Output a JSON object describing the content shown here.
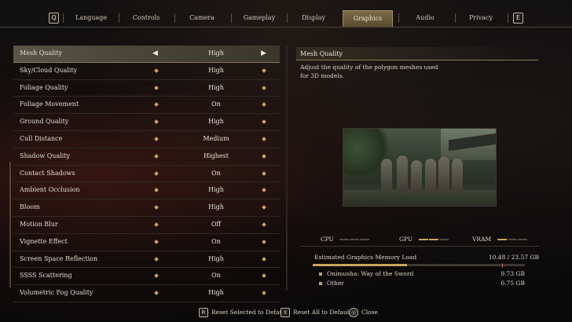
{
  "tabs": {
    "prev_key": "Q",
    "next_key": "E",
    "items": [
      "Language",
      "Controls",
      "Camera",
      "Gameplay",
      "Display",
      "Graphics",
      "Audio",
      "Privacy"
    ],
    "active": "Graphics"
  },
  "settings": [
    {
      "label": "Mesh Quality",
      "value": "High",
      "selected": true
    },
    {
      "label": "Sky/Cloud Quality",
      "value": "High"
    },
    {
      "label": "Foliage Quality",
      "value": "High"
    },
    {
      "label": "Foliage Movement",
      "value": "On"
    },
    {
      "label": "Ground Quality",
      "value": "High"
    },
    {
      "label": "Cull Distance",
      "value": "Medium"
    },
    {
      "label": "Shadow Quality",
      "value": "Highest"
    },
    {
      "label": "Contact Shadows",
      "value": "On"
    },
    {
      "label": "Ambient Occlusion",
      "value": "High"
    },
    {
      "label": "Bloom",
      "value": "High"
    },
    {
      "label": "Motion Blur",
      "value": "Off"
    },
    {
      "label": "Vignette Effect",
      "value": "On"
    },
    {
      "label": "Screen Space Reflection",
      "value": "High"
    },
    {
      "label": "SSSS Scattering",
      "value": "On"
    },
    {
      "label": "Volumetric Fog Quality",
      "value": "High"
    }
  ],
  "detail": {
    "title": "Mesh Quality",
    "description": "Adjust the quality of the polygon meshes used for 3D models."
  },
  "usage": {
    "cpu_label": "CPU",
    "cpu_level": 0,
    "gpu_label": "GPU",
    "gpu_level": 2,
    "vram_label": "VRAM",
    "vram_level": 1,
    "memory_label": "Estimated Graphics Memory Load",
    "memory_value": "10.48 / 23.57 GB",
    "memory_fraction": 0.444,
    "breakdown": [
      {
        "label": "Onimusha: Way of the Sword",
        "value": "9.73 GB"
      },
      {
        "label": "Other",
        "value": "0.75 GB"
      }
    ]
  },
  "hints": [
    {
      "key": "R",
      "label": "Reset Selected to Default"
    },
    {
      "key": "X",
      "label": "Reset All to Default"
    },
    {
      "key": "◎",
      "label": "Close"
    }
  ],
  "colors": {
    "accent": "#c9a45c",
    "selected_row": "#4a4639",
    "background": "#0b0a0a"
  }
}
